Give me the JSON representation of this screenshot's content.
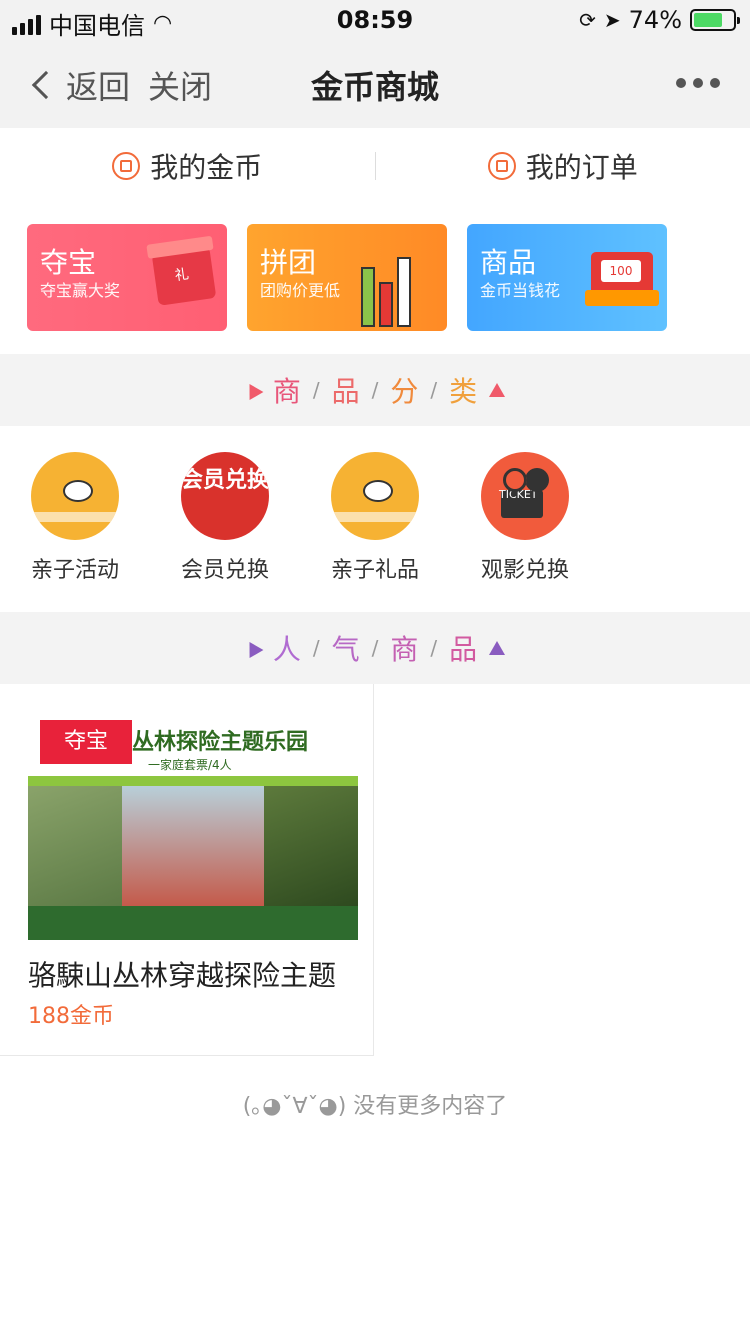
{
  "status_bar": {
    "carrier": "中国电信",
    "time": "08:59",
    "battery": "74%",
    "battery_level": 0.74
  },
  "nav": {
    "back": "返回",
    "close": "关闭",
    "title": "金币商城"
  },
  "tabs": [
    {
      "label": "我的金币"
    },
    {
      "label": "我的订单"
    }
  ],
  "banners": [
    {
      "title": "夺宝",
      "subtitle": "夺宝赢大奖"
    },
    {
      "title": "拼团",
      "subtitle": "团购价更低"
    },
    {
      "title": "商品",
      "subtitle": "金币当钱花"
    }
  ],
  "sections": {
    "categories": [
      "商",
      "品",
      "分",
      "类"
    ],
    "popular": [
      "人",
      "气",
      "商",
      "品"
    ],
    "categories_color": [
      "#e8567a",
      "#f08a3c"
    ],
    "popular_color": [
      "#b06bd1",
      "#d25aa0"
    ]
  },
  "categories": [
    {
      "label": "亲子活动"
    },
    {
      "label": "会员兑换",
      "icon_text": "会员兑换"
    },
    {
      "label": "亲子礼品"
    },
    {
      "label": "观影兑换",
      "icon_text": "TICKET"
    }
  ],
  "product": {
    "tag": "夺宝",
    "image_title": "丛林探险主题乐园",
    "image_subtitle": "一家庭套票/4人",
    "name": "骆駷山丛林穿越探险主题",
    "price": "188金币"
  },
  "footer": {
    "no_more": "(｡◕ˇ∀ˇ◕)  没有更多内容了"
  }
}
